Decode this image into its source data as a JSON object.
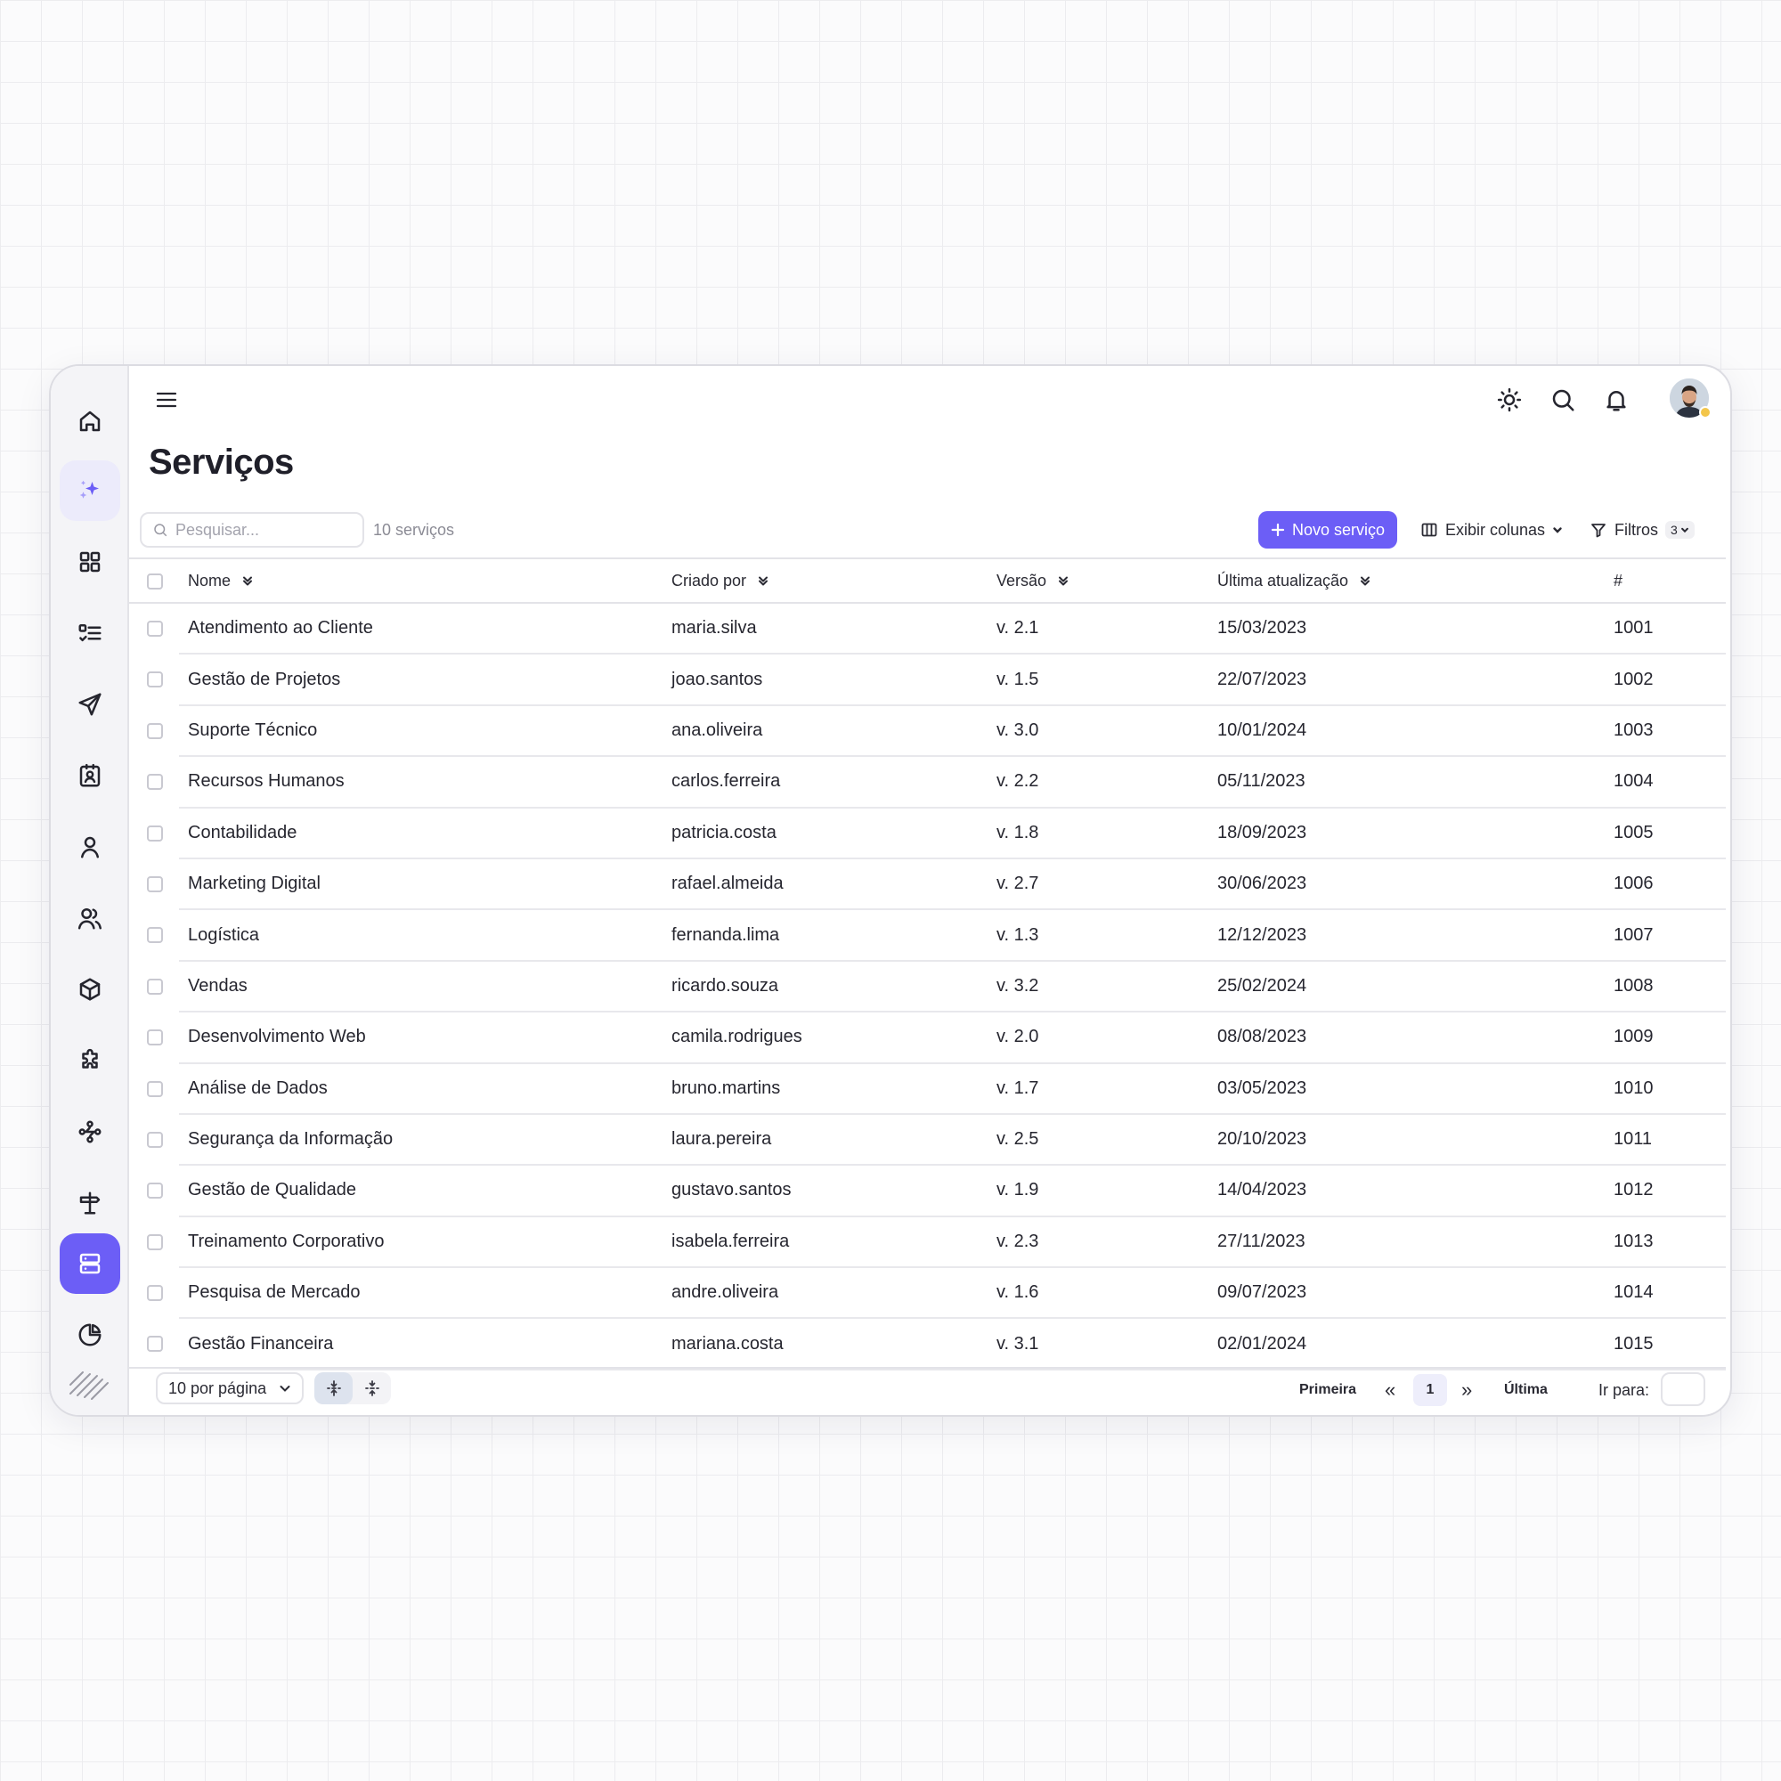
{
  "header": {
    "title": "Serviços"
  },
  "toolbar": {
    "search_placeholder": "Pesquisar...",
    "count": "10 serviços",
    "new_button": "Novo serviço",
    "columns_button": "Exibir colunas",
    "filters_button": "Filtros",
    "filters_count": "3"
  },
  "sidebar": {
    "items": [
      {
        "icon": "home-icon"
      },
      {
        "icon": "sparkles-icon"
      },
      {
        "icon": "dashboard-icon"
      },
      {
        "icon": "checklist-icon"
      },
      {
        "icon": "send-icon"
      },
      {
        "icon": "contact-card-icon"
      },
      {
        "icon": "user-icon"
      },
      {
        "icon": "users-icon"
      },
      {
        "icon": "box-icon"
      },
      {
        "icon": "puzzle-icon"
      },
      {
        "icon": "workflow-icon"
      },
      {
        "icon": "signpost-icon"
      },
      {
        "icon": "server-icon",
        "active": true
      },
      {
        "icon": "pie-chart-icon"
      }
    ]
  },
  "table": {
    "columns": [
      "Nome",
      "Criado por",
      "Versão",
      "Última atualização",
      "#"
    ],
    "rows": [
      [
        "Atendimento ao Cliente",
        "maria.silva",
        "v. 2.1",
        "15/03/2023",
        "1001"
      ],
      [
        "Gestão de Projetos",
        "joao.santos",
        "v. 1.5",
        "22/07/2023",
        "1002"
      ],
      [
        "Suporte Técnico",
        "ana.oliveira",
        "v. 3.0",
        "10/01/2024",
        "1003"
      ],
      [
        "Recursos Humanos",
        "carlos.ferreira",
        "v. 2.2",
        "05/11/2023",
        "1004"
      ],
      [
        "Contabilidade",
        "patricia.costa",
        "v. 1.8",
        "18/09/2023",
        "1005"
      ],
      [
        "Marketing Digital",
        "rafael.almeida",
        "v. 2.7",
        "30/06/2023",
        "1006"
      ],
      [
        "Logística",
        "fernanda.lima",
        "v. 1.3",
        "12/12/2023",
        "1007"
      ],
      [
        "Vendas",
        "ricardo.souza",
        "v. 3.2",
        "25/02/2024",
        "1008"
      ],
      [
        "Desenvolvimento Web",
        "camila.rodrigues",
        "v. 2.0",
        "08/08/2023",
        "1009"
      ],
      [
        "Análise de Dados",
        "bruno.martins",
        "v. 1.7",
        "03/05/2023",
        "1010"
      ],
      [
        "Segurança da Informação",
        "laura.pereira",
        "v. 2.5",
        "20/10/2023",
        "1011"
      ],
      [
        "Gestão de Qualidade",
        "gustavo.santos",
        "v. 1.9",
        "14/04/2023",
        "1012"
      ],
      [
        "Treinamento Corporativo",
        "isabela.ferreira",
        "v. 2.3",
        "27/11/2023",
        "1013"
      ],
      [
        "Pesquisa de Mercado",
        "andre.oliveira",
        "v. 1.6",
        "09/07/2023",
        "1014"
      ],
      [
        "Gestão Financeira",
        "mariana.costa",
        "v. 3.1",
        "02/01/2024",
        "1015"
      ]
    ]
  },
  "pagination": {
    "per_page": "10 por página",
    "first": "Primeira",
    "prev": "«",
    "current": "1",
    "next": "»",
    "last": "Última",
    "goto_label": "Ir para:"
  },
  "colors": {
    "accent": "#6c5ef6",
    "status_dot": "#f3c64a"
  }
}
